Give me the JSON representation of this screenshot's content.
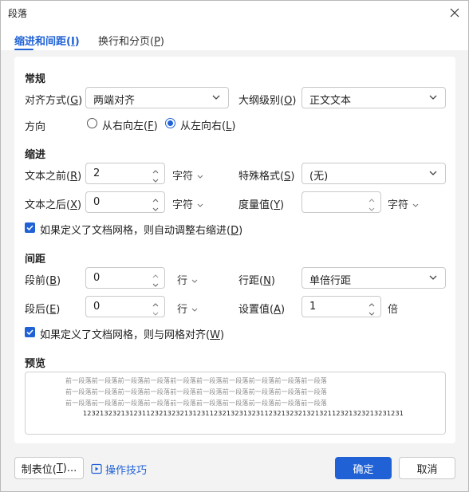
{
  "window": {
    "title": "段落"
  },
  "tabs": [
    {
      "label": "缩进和间距(",
      "key": "I",
      "suffix": ")",
      "active": true
    },
    {
      "label": "换行和分页(",
      "key": "P",
      "suffix": ")",
      "active": false
    }
  ],
  "general": {
    "heading": "常规",
    "alignment": {
      "label": "对齐方式(",
      "key": "G",
      "suffix": ")",
      "value": "两端对齐"
    },
    "outline": {
      "label": "大纲级别(",
      "key": "O",
      "suffix": ")",
      "value": "正文文本"
    },
    "direction": {
      "label": "方向",
      "rtl": {
        "label": "从右向左(",
        "key": "F",
        "suffix": ")",
        "selected": false
      },
      "ltr": {
        "label": "从左向右(",
        "key": "L",
        "suffix": ")",
        "selected": true
      }
    }
  },
  "indent": {
    "heading": "缩进",
    "before": {
      "label": "文本之前(",
      "key": "R",
      "suffix": ")",
      "value": "2",
      "unit": "字符"
    },
    "after": {
      "label": "文本之后(",
      "key": "X",
      "suffix": ")",
      "value": "0",
      "unit": "字符"
    },
    "special": {
      "label": "特殊格式(",
      "key": "S",
      "suffix": ")",
      "value": "(无)"
    },
    "measure": {
      "label": "度量值(",
      "key": "Y",
      "suffix": ")",
      "value": "",
      "unit": "字符"
    },
    "auto_adjust": {
      "label": "如果定义了文档网格，则自动调整右缩进(",
      "key": "D",
      "suffix": ")",
      "checked": true
    }
  },
  "spacing": {
    "heading": "间距",
    "before": {
      "label": "段前(",
      "key": "B",
      "suffix": ")",
      "value": "0",
      "unit": "行"
    },
    "after": {
      "label": "段后(",
      "key": "E",
      "suffix": ")",
      "value": "0",
      "unit": "行"
    },
    "line_spacing": {
      "label": "行距(",
      "key": "N",
      "suffix": ")",
      "value": "单倍行距"
    },
    "set_value": {
      "label": "设置值(",
      "key": "A",
      "suffix": ")",
      "value": "1",
      "unit": "倍"
    },
    "snap_grid": {
      "label": "如果定义了文档网格，则与网格对齐(",
      "key": "W",
      "suffix": ")",
      "checked": true
    }
  },
  "preview": {
    "heading": "预览",
    "lines": [
      "前一段落前一段落前一段落前一段落前一段落前一段落前一段落前一段落前一段落前一段落",
      "前一段落前一段落前一段落前一段落前一段落前一段落前一段落前一段落前一段落前一段落",
      "前一段落前一段落前一段落前一段落前一段落前一段落前一段落前一段落前一段落前一段落",
      "1232132321312311232132321312311232132313231123213232132132112321323213231231"
    ]
  },
  "footer": {
    "tabs_button": {
      "label": "制表位(",
      "key": "T",
      "suffix": ")..."
    },
    "tips_link": "操作技巧",
    "ok": "确定",
    "cancel": "取消"
  },
  "colors": {
    "accent": "#2062d6",
    "panel": "#ffffff",
    "window_bg": "#f3f3f3"
  }
}
